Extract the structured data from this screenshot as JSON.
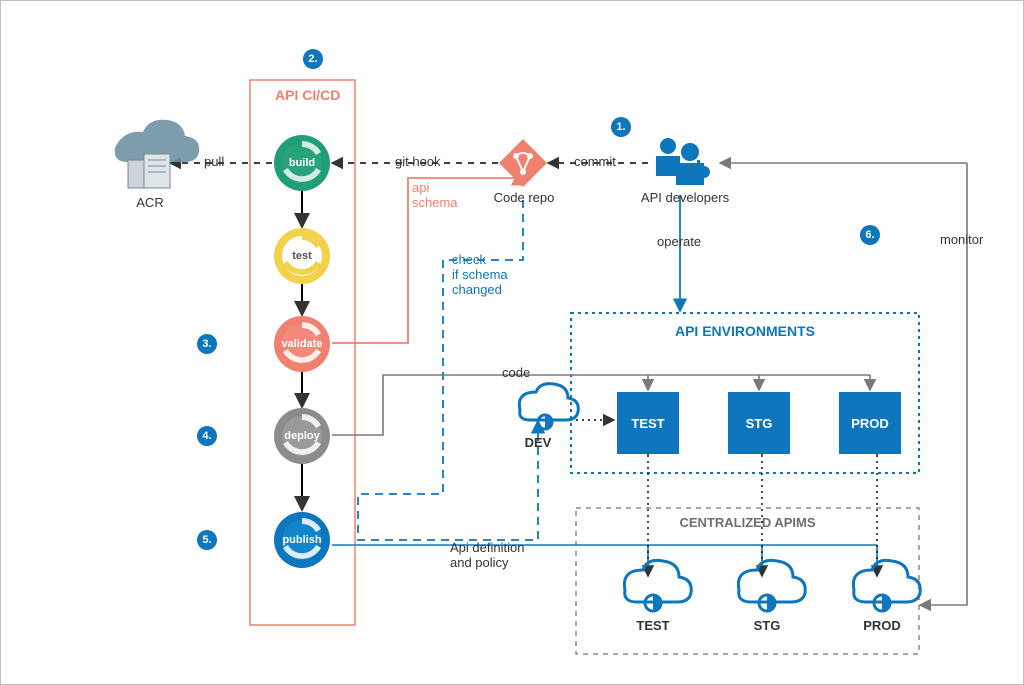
{
  "badges": {
    "b1": "1.",
    "b2": "2.",
    "b3": "3.",
    "b4": "4.",
    "b5": "5.",
    "b6": "6."
  },
  "pipeline": {
    "title": "API CI/CD",
    "steps": {
      "build": "build",
      "test": "test",
      "validate": "validate",
      "deploy": "deploy",
      "publish": "publish"
    }
  },
  "nodes": {
    "acr": "ACR",
    "codeRepo": "Code repo",
    "devs": "API developers",
    "dev": "DEV",
    "envTitle": "API ENVIRONMENTS",
    "envTest": "TEST",
    "envStg": "STG",
    "envProd": "PROD",
    "apimsTitle": "CENTRALIZED APIMS",
    "apimTest": "TEST",
    "apimStg": "STG",
    "apimProd": "PROD"
  },
  "edges": {
    "pull": "pull",
    "gitHook": "git hook",
    "commit": "commit",
    "apiSchema": "api\nschema",
    "checkSchema": "check\nif schema\nchanged",
    "operate": "operate",
    "monitor": "monitor",
    "code": "code",
    "apiDefPolicy": "Api definition\nand policy"
  }
}
